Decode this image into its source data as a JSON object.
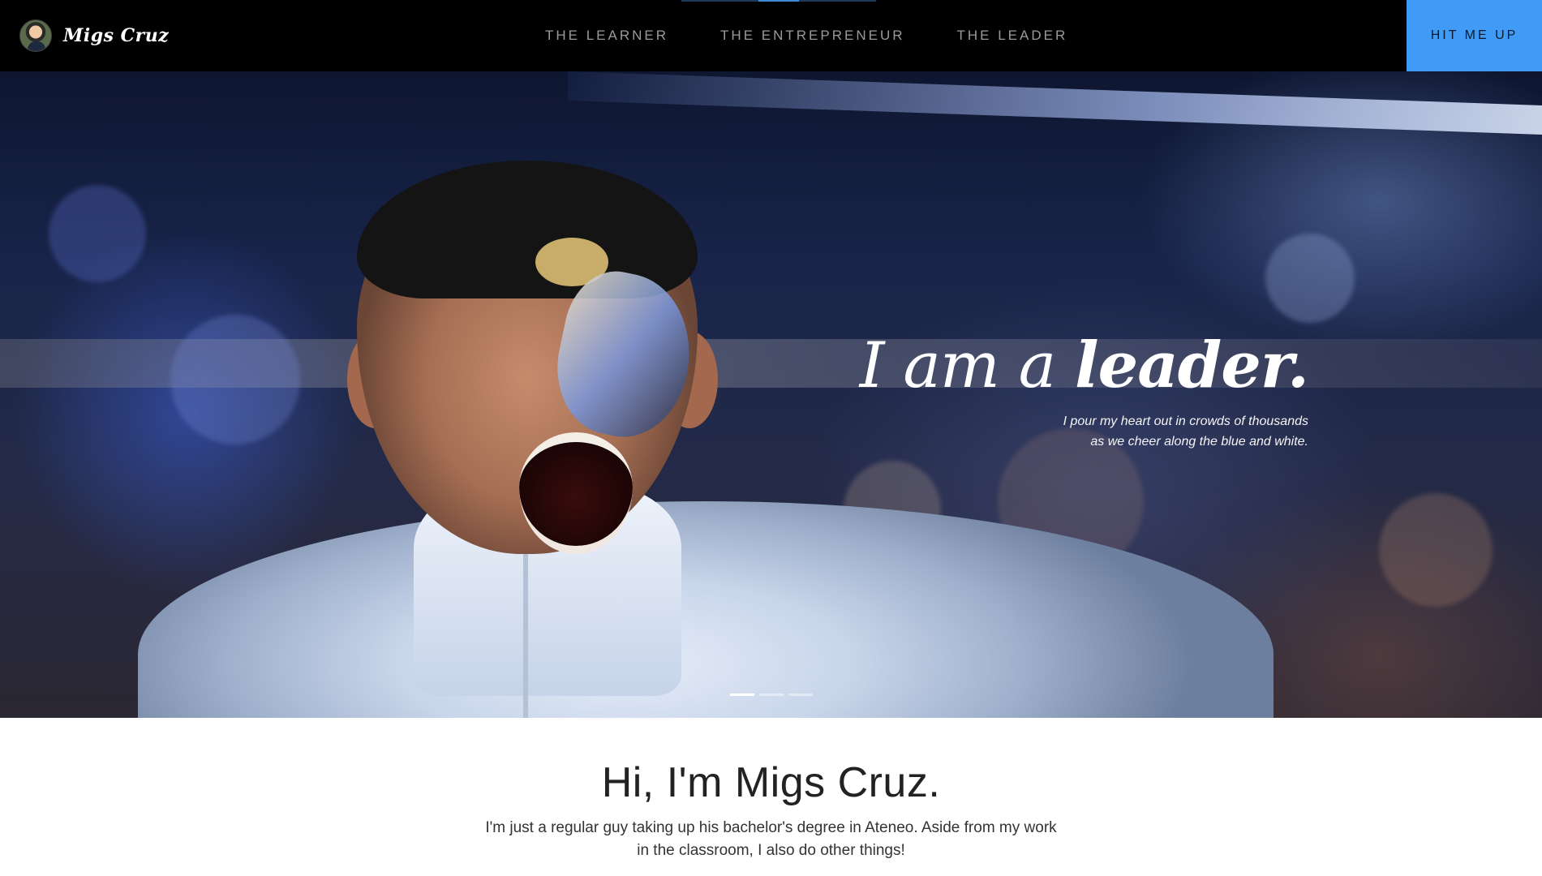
{
  "brand": {
    "name": "Migs Cruz"
  },
  "nav": {
    "links": [
      {
        "label": "THE LEARNER"
      },
      {
        "label": "THE ENTREPRENEUR"
      },
      {
        "label": "THE LEADER"
      }
    ],
    "cta_label": "HIT ME UP"
  },
  "hero": {
    "title_light": "I am a ",
    "title_bold": "leader",
    "title_period": ".",
    "subtitle_line1": "I pour my heart out in crowds of thousands",
    "subtitle_line2": "as we cheer along the blue and white.",
    "slides": 3,
    "active_slide": 1
  },
  "intro": {
    "title": "Hi, I'm Migs Cruz.",
    "text_line1": "I'm just a regular guy taking up his bachelor's degree in Ateneo. Aside from my work",
    "text_line2": "in the classroom, I also do other things!"
  },
  "colors": {
    "navbar_bg": "#000000",
    "cta_bg": "#3f9bf5",
    "nav_link": "#9a9a9a"
  }
}
